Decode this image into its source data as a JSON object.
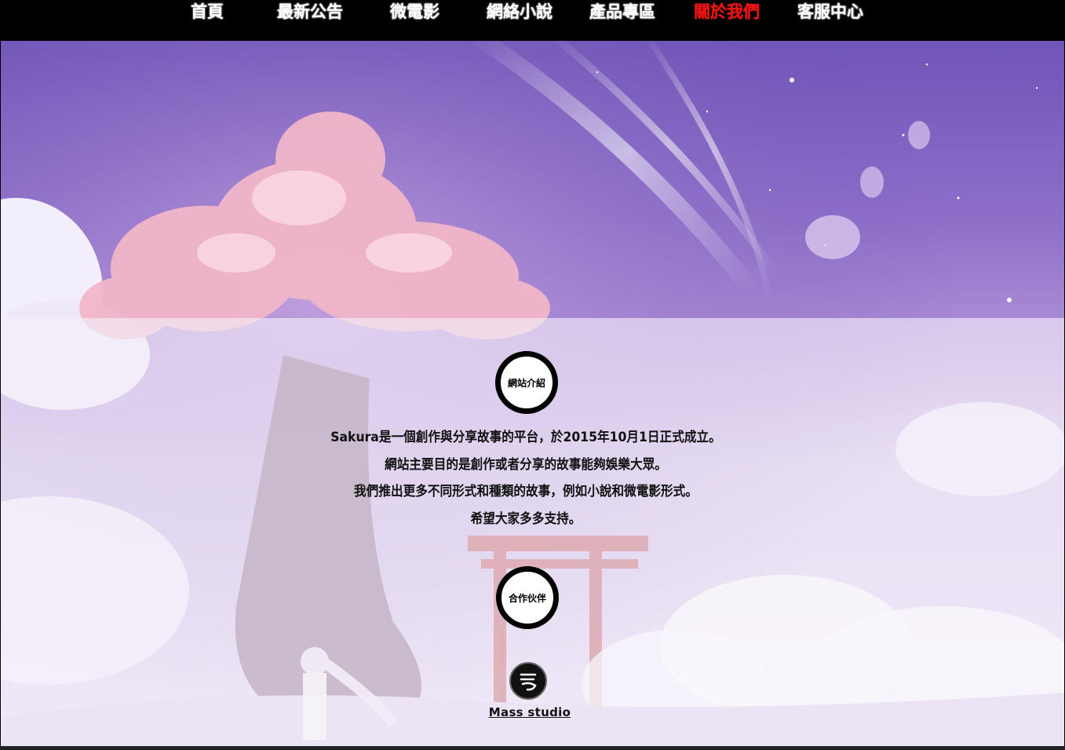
{
  "nav": {
    "items": [
      {
        "label": "首頁",
        "active": false
      },
      {
        "label": "最新公告",
        "active": false
      },
      {
        "label": "微電影",
        "active": false
      },
      {
        "label": "網絡小說",
        "active": false
      },
      {
        "label": "產品專區",
        "active": false
      },
      {
        "label": "關於我們",
        "active": true
      },
      {
        "label": "客服中心",
        "active": false
      }
    ],
    "active_color": "#ee1111"
  },
  "intro": {
    "badge_label": "網站介紹",
    "lines": [
      "Sakura是一個創作與分享故事的平台，於2015年10月1日正式成立。",
      "網站主要目的是創作或者分享的故事能夠娛樂大眾。",
      "我們推出更多不同形式和種類的故事，例如小說和微電影形式。",
      "希望大家多多支持。"
    ]
  },
  "partners": {
    "badge_label": "合作伙伴",
    "items": [
      {
        "name": "Mass studio",
        "icon": "mass-studio-logo-icon"
      }
    ]
  }
}
